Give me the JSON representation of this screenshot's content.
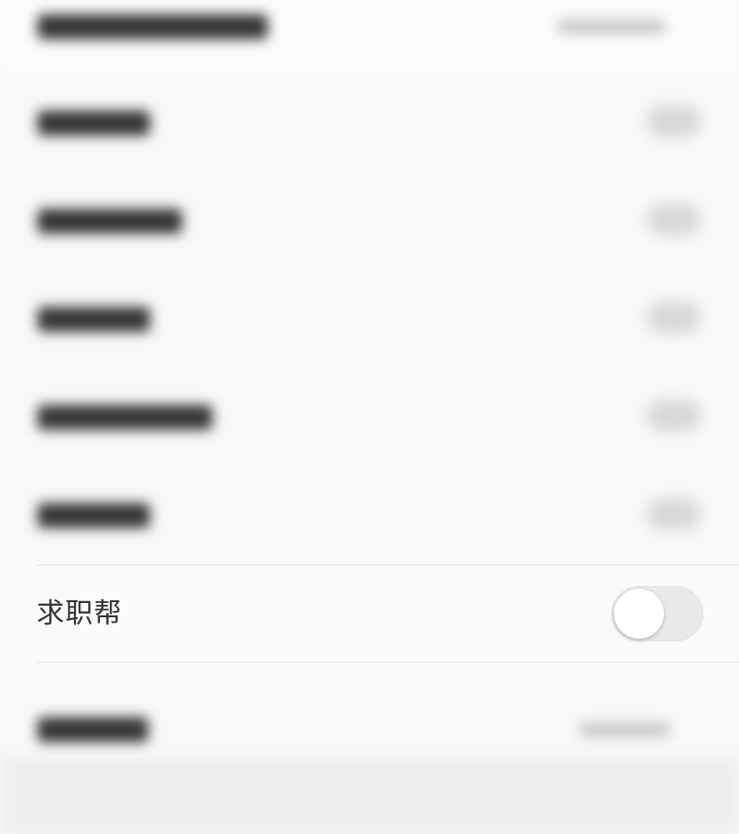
{
  "settings": {
    "row_label": "求职帮",
    "toggle_on": false
  },
  "colors": {
    "background": "#f8f8f9",
    "label_text": "#333333",
    "toggle_off_track": "#e9e9ea",
    "toggle_thumb": "#ffffff",
    "divider": "#e6e6e6"
  }
}
